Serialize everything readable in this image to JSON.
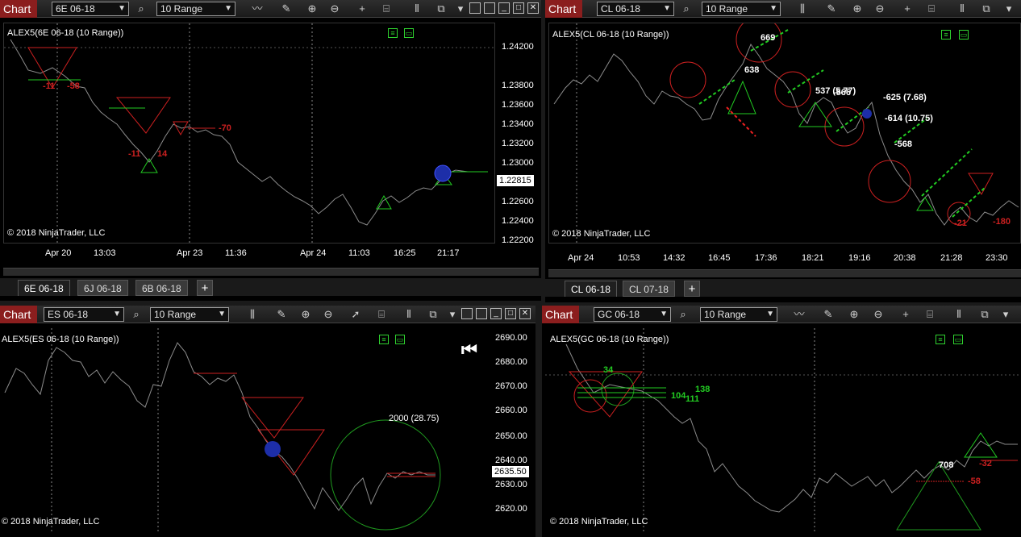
{
  "app": {
    "chart_tab": "Chart"
  },
  "colors": {
    "bull": "#22cc22",
    "bear": "#cc2020",
    "price": "#8c8c8c",
    "white": "#ffffff"
  },
  "panels": {
    "tl": {
      "instrument": "6E 06-18",
      "range": "10 Range",
      "label": "ALEX5(6E 06-18 (10 Range))",
      "copyright": "© 2018 NinjaTrader, LLC",
      "yticks": [
        "1.24200",
        "1.23800",
        "1.23600",
        "1.23400",
        "1.23200",
        "1.23000",
        "1.22600",
        "1.22400",
        "1.22200"
      ],
      "price": "1.22815",
      "xticks": [
        "Apr 20",
        "13:03",
        "Apr 23",
        "11:36",
        "Apr 24",
        "11:03",
        "16:25",
        "21:17"
      ],
      "tabs": [
        "6E 06-18",
        "6J 06-18",
        "6B 06-18"
      ],
      "annotations": [
        "-11",
        "-58",
        "-11",
        "14",
        "-70"
      ]
    },
    "tr": {
      "instrument": "CL 06-18",
      "range": "10 Range",
      "label": "ALEX5(CL 06-18 (10 Range))",
      "copyright": "© 2018 NinjaTrader, LLC",
      "xticks": [
        "Apr 24",
        "10:53",
        "14:32",
        "16:45",
        "17:36",
        "18:21",
        "19:16",
        "20:38",
        "21:28",
        "23:30"
      ],
      "tabs": [
        "CL 06-18",
        "CL 07-18"
      ],
      "annotations": [
        "669",
        "638",
        "537 (5.77)",
        "-566",
        "-625 (7.68)",
        "-614 (10.75)",
        "-568",
        "-21",
        "-180"
      ]
    },
    "bl": {
      "instrument": "ES 06-18",
      "range": "10 Range",
      "label": "ALEX5(ES 06-18 (10 Range))",
      "copyright": "© 2018 NinjaTrader, LLC",
      "yticks": [
        "2690.00",
        "2680.00",
        "2670.00",
        "2660.00",
        "2650.00",
        "2640.00",
        "2630.00",
        "2620.00"
      ],
      "price": "2635.50",
      "annotations": [
        "2000 (28.75)"
      ]
    },
    "br": {
      "instrument": "GC 06-18",
      "range": "10 Range",
      "label": "ALEX5(GC 06-18 (10 Range))",
      "copyright": "© 2018 NinjaTrader, LLC",
      "annotations": [
        "34",
        "138",
        "104",
        "111",
        "708",
        "-32",
        "-58"
      ]
    }
  }
}
